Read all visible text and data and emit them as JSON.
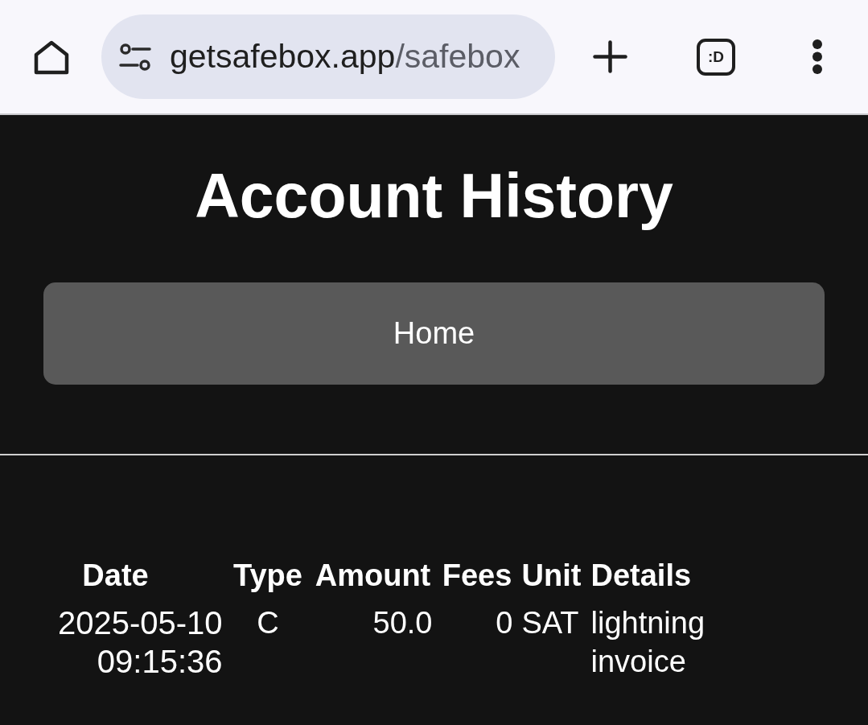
{
  "browser_toolbar": {
    "url": {
      "host": "getsafebox.app",
      "path": "/safebox"
    },
    "tab_switcher": {
      "label": ":D"
    }
  },
  "page": {
    "title": "Account History",
    "home_button": {
      "label": "Home"
    }
  },
  "table": {
    "columns": [
      "Date",
      "Type",
      "Amount",
      "Fees",
      "Unit",
      "Details"
    ],
    "rows": [
      [
        "2025-05-10 09:15:36",
        "C",
        "50.0",
        "0",
        "SAT",
        "lightning invoice"
      ]
    ]
  }
}
